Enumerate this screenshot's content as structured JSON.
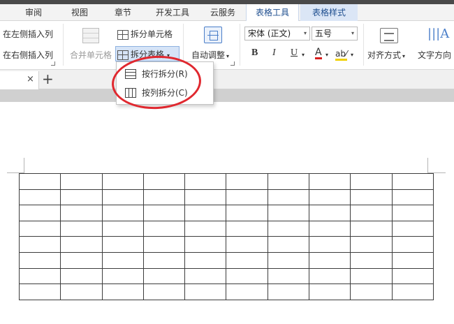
{
  "menu": {
    "tabs": [
      {
        "label": "审阅"
      },
      {
        "label": "视图"
      },
      {
        "label": "章节"
      },
      {
        "label": "开发工具"
      },
      {
        "label": "云服务"
      },
      {
        "label": "表格工具"
      },
      {
        "label": "表格样式"
      }
    ]
  },
  "ribbon": {
    "insert_left_col": "在左侧插入列",
    "insert_right_col": "在右侧插入列",
    "merge_cells": "合并单元格",
    "split_cells": "拆分单元格",
    "split_table": "拆分表格",
    "auto_fit": "自动调整",
    "font_name": "宋体 (正文)",
    "font_size": "五号",
    "bold": "B",
    "italic": "I",
    "underline": "U",
    "font_color_glyph": "A",
    "highlight_glyph": "ab⁄",
    "align": "对齐方式",
    "text_direction": "文字方向",
    "text_dir_glyph": "A"
  },
  "split_menu": {
    "items": [
      {
        "label": "按行拆分(R)"
      },
      {
        "label": "按列拆分(C)"
      }
    ]
  },
  "doc_tabs": {
    "close_glyph": "×",
    "add_glyph": "+"
  },
  "colors": {
    "context_tab_bg": "#dbe6f6",
    "accent_blue": "#4b7fc9",
    "annotation_red": "#e0282f"
  },
  "table": {
    "rows": 8,
    "cols": 10
  }
}
